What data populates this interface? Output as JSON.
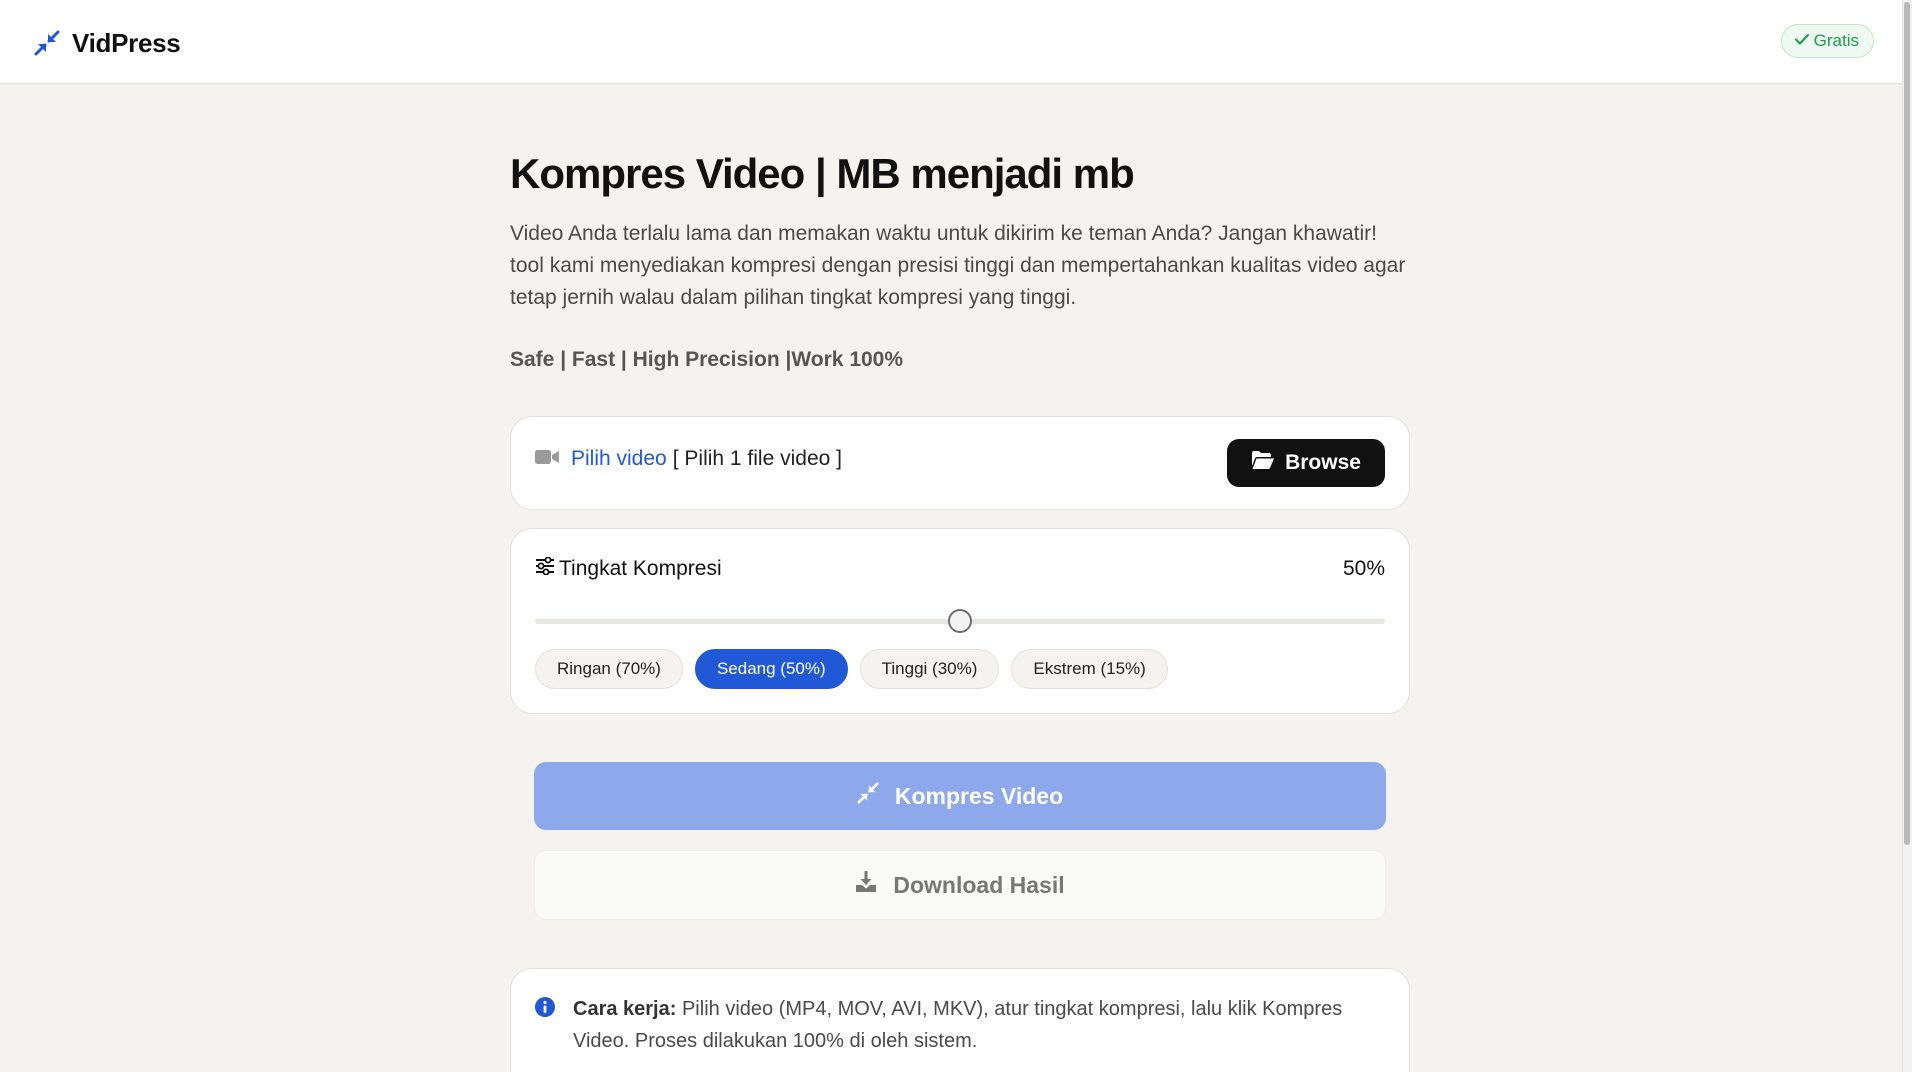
{
  "header": {
    "brand_name": "VidPress",
    "badge_label": "Gratis"
  },
  "hero": {
    "title": "Kompres Video | MB menjadi mb",
    "description": "Video Anda terlalu lama dan memakan waktu untuk dikirim ke teman Anda? Jangan khawatir! tool kami menyediakan kompresi dengan presisi tinggi dan mempertahankan kualitas video agar tetap jernih walau dalam pilihan tingkat kompresi yang tinggi.",
    "tagline": "Safe | Fast | High Precision |Work 100%"
  },
  "file_picker": {
    "link_label": "Pilih video",
    "hint": "[ Pilih 1 file video ]",
    "browse_label": "Browse"
  },
  "compression": {
    "title": "Tingkat Kompresi",
    "value_label": "50%",
    "slider_value": 50,
    "presets": [
      {
        "label": "Ringan (70%)",
        "active": false
      },
      {
        "label": "Sedang (50%)",
        "active": true
      },
      {
        "label": "Tinggi (30%)",
        "active": false
      },
      {
        "label": "Ekstrem (15%)",
        "active": false
      }
    ]
  },
  "actions": {
    "compress_label": "Kompres Video",
    "download_label": "Download Hasil"
  },
  "info": {
    "label": "Cara kerja:",
    "text": " Pilih video (MP4, MOV, AVI, MKV), atur tingkat kompresi, lalu klik Kompres Video. Proses dilakukan 100% di oleh sistem."
  },
  "colors": {
    "accent": "#2158d6",
    "compress_button": "#8da9ec",
    "badge_green": "#1f9d4f",
    "background": "#f4f3ef"
  },
  "icons": {
    "logo": "compress-arrows-icon",
    "badge": "check-icon",
    "file": "video-camera-icon",
    "browse": "folder-open-icon",
    "level": "sliders-icon",
    "compress": "compress-arrows-icon",
    "download": "download-icon",
    "info": "info-circle-icon"
  }
}
